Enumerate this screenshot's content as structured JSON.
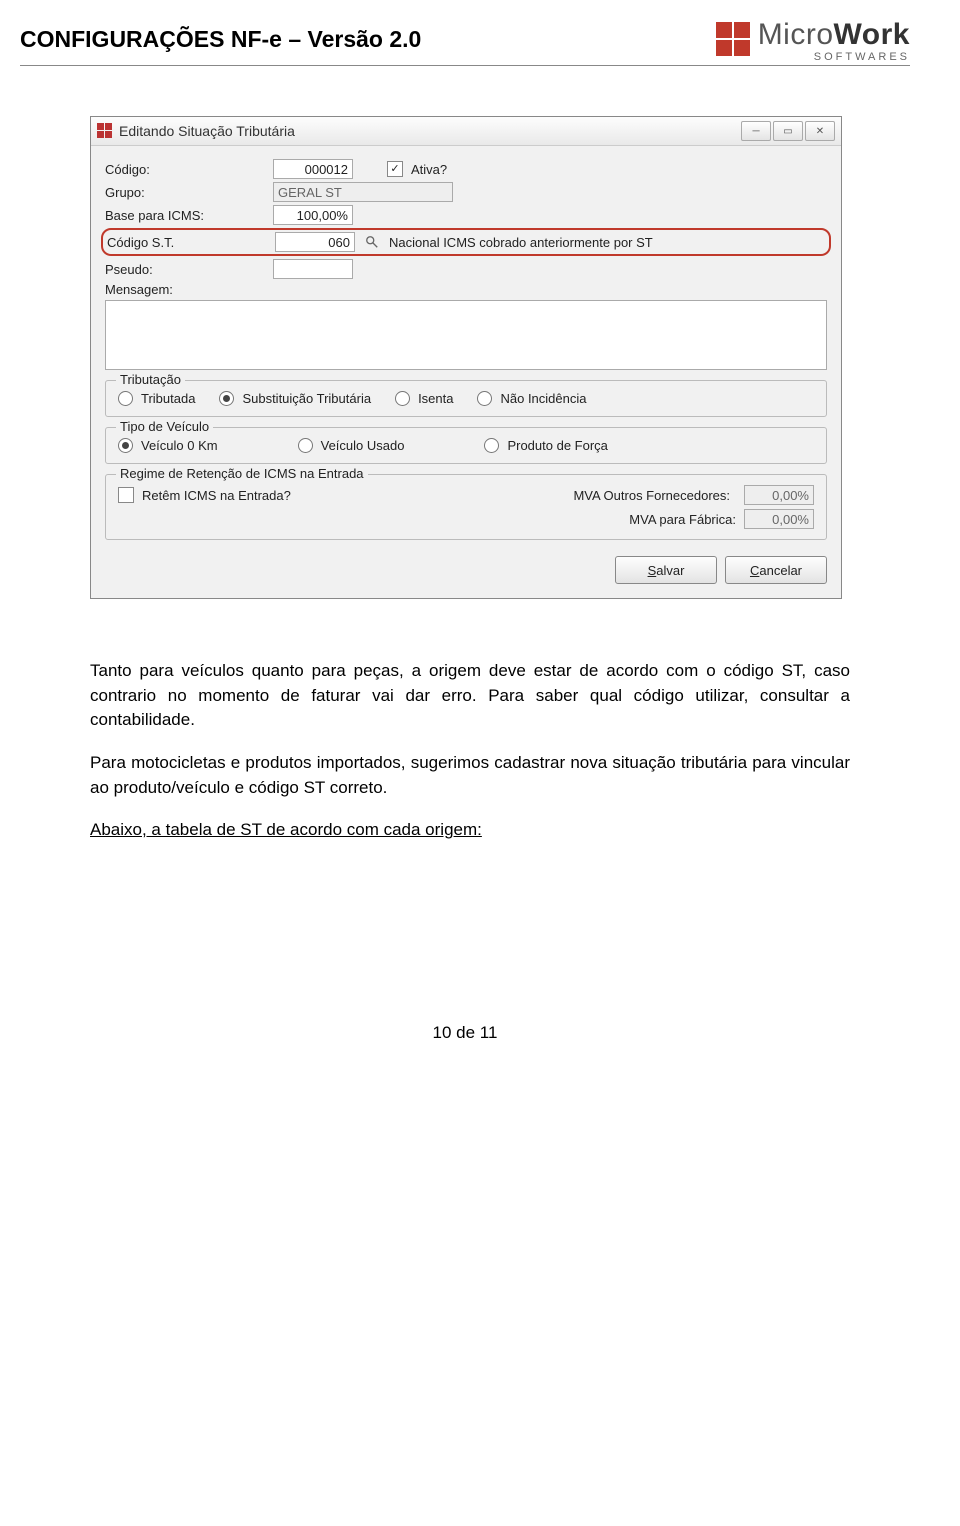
{
  "header": {
    "title": "CONFIGURAÇÕES NF-e – Versão 2.0",
    "logo_main_light": "Micro",
    "logo_main_bold": "Work",
    "logo_sub": "SOFTWARES"
  },
  "dialog": {
    "title": "Editando Situação Tributária",
    "labels": {
      "codigo": "Código:",
      "grupo": "Grupo:",
      "base_icms": "Base para ICMS:",
      "codigo_st": "Código S.T.",
      "pseudo": "Pseudo:",
      "mensagem": "Mensagem:"
    },
    "values": {
      "codigo": "000012",
      "grupo": "GERAL ST",
      "base_icms": "100,00%",
      "codigo_st": "060",
      "codigo_st_desc": "Nacional ICMS cobrado anteriormente por ST",
      "pseudo": "",
      "ativa_checked": "✓",
      "ativa_label": "Ativa?"
    },
    "grp_trib": {
      "title": "Tributação",
      "opts": {
        "tributada": "Tributada",
        "sub_trib": "Substituição Tributária",
        "isenta": "Isenta",
        "nao_inc": "Não Incidência"
      }
    },
    "grp_veic": {
      "title": "Tipo de Veículo",
      "opts": {
        "km0": "Veículo 0 Km",
        "usado": "Veículo Usado",
        "forca": "Produto de Força"
      }
    },
    "grp_reg": {
      "title": "Regime de  Retenção de ICMS na Entrada",
      "chk_label": "Retêm ICMS na Entrada?",
      "mva_outros_label": "MVA Outros Fornecedores:",
      "mva_outros_val": "0,00%",
      "mva_fab_label": "MVA para Fábrica:",
      "mva_fab_val": "0,00%"
    },
    "buttons": {
      "salvar_u": "S",
      "salvar_rest": "alvar",
      "cancelar_u": "C",
      "cancelar_rest": "ancelar"
    }
  },
  "body": {
    "p1": "Tanto para veículos quanto para peças, a origem deve estar de acordo com o código ST, caso contrario no momento de faturar vai dar erro. Para saber qual   código   utilizar, consultar a contabilidade.",
    "p2": "Para motocicletas e produtos importados, sugerimos cadastrar nova situação tributária para vincular ao produto/veículo e código ST correto.",
    "p3": "Abaixo, a tabela de ST de acordo com cada origem:"
  },
  "footer": {
    "page": "10 de 11"
  }
}
